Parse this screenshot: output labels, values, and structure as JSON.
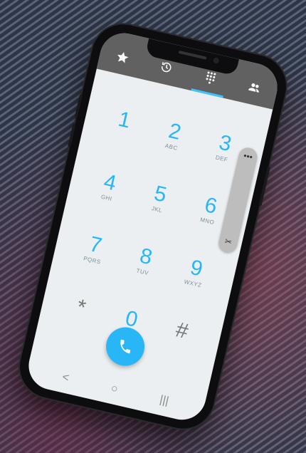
{
  "tabs": [
    {
      "name": "favorites",
      "icon": "star-icon"
    },
    {
      "name": "recents",
      "icon": "history-icon"
    },
    {
      "name": "dialpad",
      "icon": "dialpad-icon",
      "active": true
    },
    {
      "name": "contacts",
      "icon": "people-icon"
    }
  ],
  "dialpad": {
    "keys": [
      {
        "digit": "1",
        "letters": ""
      },
      {
        "digit": "2",
        "letters": "ABC"
      },
      {
        "digit": "3",
        "letters": "DEF"
      },
      {
        "digit": "4",
        "letters": "GHI"
      },
      {
        "digit": "5",
        "letters": "JKL"
      },
      {
        "digit": "6",
        "letters": "MNO"
      },
      {
        "digit": "7",
        "letters": "PQRS"
      },
      {
        "digit": "8",
        "letters": "TUV"
      },
      {
        "digit": "9",
        "letters": "WXYZ"
      },
      {
        "digit": "*",
        "letters": ""
      },
      {
        "digit": "0",
        "letters": "+"
      },
      {
        "digit": "#",
        "letters": ""
      }
    ]
  },
  "navbar": {
    "back": "<",
    "home": "○",
    "recents": "|||"
  },
  "edge_panel": {
    "menu_icon": "more-horizontal-icon",
    "tool_icon": "scissors-icon"
  },
  "colors": {
    "accent": "#29b6f6",
    "appbar": "#616161",
    "screen_bg": "#eceff1"
  }
}
